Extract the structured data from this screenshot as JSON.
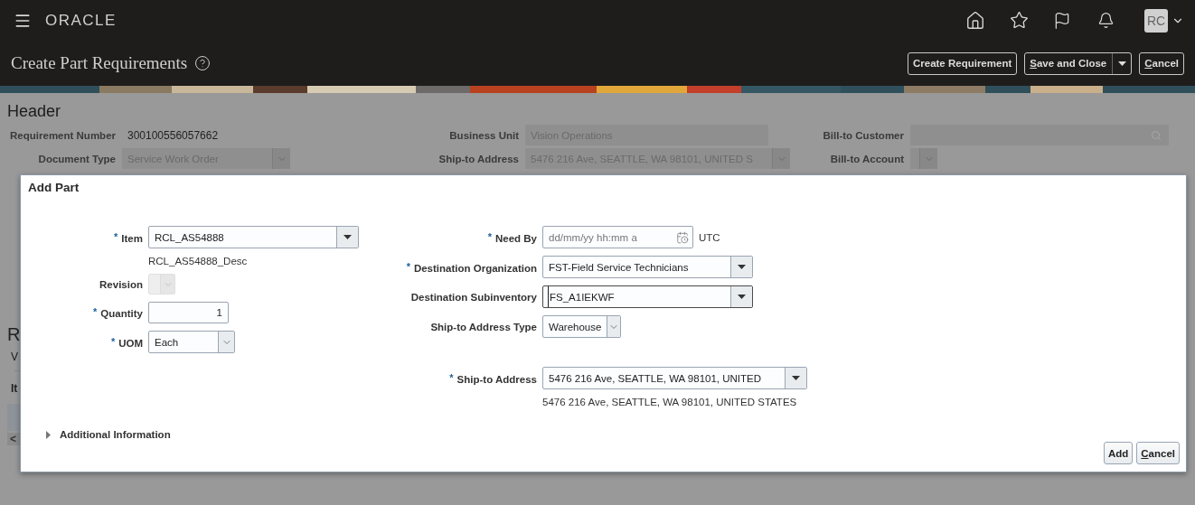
{
  "app_bar": {
    "logo": "ORACLE",
    "avatar": "RC"
  },
  "page": {
    "title": "Create Part Requirements",
    "buttons": [
      {
        "label": "Create Requirement",
        "kind": "plain",
        "mnemonic": false
      },
      {
        "label": "Save and Close",
        "kind": "split",
        "mnemonic": true
      },
      {
        "label": "Cancel",
        "kind": "plain",
        "mnemonic": true
      }
    ]
  },
  "header": {
    "title": "Header",
    "fields": [
      {
        "kind": "text",
        "label": "Requirement Number",
        "value": "300100556057662"
      },
      {
        "kind": "input",
        "label": "Business Unit",
        "value": "Vision Operations"
      },
      {
        "kind": "search",
        "label": "Bill-to Customer"
      },
      {
        "kind": "select",
        "label": "Document Type",
        "value": "Service Work Order"
      },
      {
        "kind": "select",
        "label": "Ship-to Address",
        "value": "5476 216 Ave, SEATTLE, WA 98101, UNITED S"
      },
      {
        "kind": "select",
        "label": "Bill-to Account"
      }
    ]
  },
  "lines": {
    "heading": "R",
    "tab": "V",
    "column_1": "It",
    "scroll_left": "<"
  },
  "dialog": {
    "title": "Add Part",
    "left_fields": [
      {
        "kind": "lov",
        "label": "Item",
        "marker": "*",
        "disabled": false,
        "focused": false,
        "value": "RCL_AS54888",
        "description": "RCL_AS54888_Desc"
      },
      {
        "kind": "choice",
        "label": "Revision",
        "disabled": true,
        "focused": false
      },
      {
        "kind": "number",
        "label": "Quantity",
        "marker": "*",
        "disabled": false,
        "focused": false,
        "value": "1"
      },
      {
        "kind": "choice",
        "label": "UOM",
        "marker": "*",
        "disabled": false,
        "focused": false,
        "value": "Each"
      }
    ],
    "right_groups": [
      [
        {
          "kind": "date",
          "label": "Need By",
          "marker": "*",
          "disabled": false,
          "focused": false,
          "placeholder": "dd/mm/yy hh:mm a",
          "suffix": "UTC"
        },
        {
          "kind": "lov",
          "label": "Destination Organization",
          "marker": "*",
          "disabled": false,
          "focused": false,
          "value": "FST-Field Service Technicians"
        },
        {
          "kind": "lov",
          "label": "Destination Subinventory",
          "disabled": false,
          "focused": true,
          "value": "FS_A1IEKWF"
        },
        {
          "kind": "choice",
          "label": "Ship-to Address Type",
          "disabled": false,
          "focused": false,
          "value": "Warehouse"
        }
      ],
      [
        {
          "kind": "lov",
          "label": "Ship-to Address",
          "marker": "*",
          "disabled": false,
          "focused": false,
          "value": "5476 216 Ave, SEATTLE, WA 98101, UNITED",
          "description": "5476 216 Ave, SEATTLE, WA 98101, UNITED STATES"
        }
      ]
    ],
    "section": {
      "label": "Additional Information",
      "expanded": false
    },
    "buttons": [
      {
        "label": "Add",
        "mnemonic": false
      },
      {
        "label": "Cancel",
        "mnemonic": true
      }
    ]
  }
}
